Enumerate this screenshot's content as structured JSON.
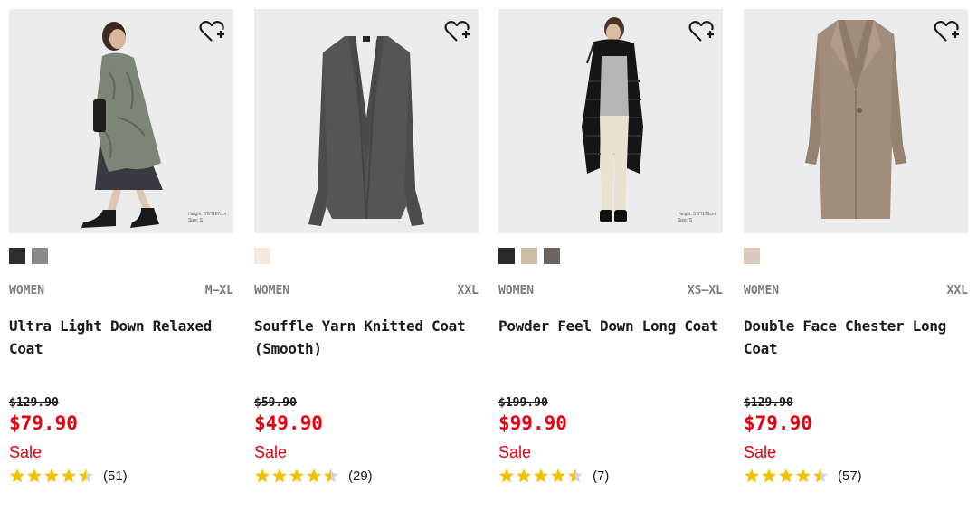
{
  "products": [
    {
      "gender": "WOMEN",
      "sizes": "M–XL",
      "title": "Ultra Light Down Relaxed Coat",
      "old_price": "$129.90",
      "price": "$79.90",
      "sale_label": "Sale",
      "rating": 4.5,
      "review_count": "(51)",
      "model_height": "Height: 5'6\"/167cm",
      "model_size": "Size: S",
      "swatch_colors": [
        "#2e2e2e",
        "#8a8a8a"
      ],
      "image": "woman-in-green-quilted-coat"
    },
    {
      "gender": "WOMEN",
      "sizes": "XXL",
      "title": "Souffle Yarn Knitted Coat (Smooth)",
      "old_price": "$59.90",
      "price": "$49.90",
      "sale_label": "Sale",
      "rating": 4.5,
      "review_count": "(29)",
      "swatch_colors": [
        "#f7e9dc"
      ],
      "image": "gray-knitted-long-coat"
    },
    {
      "gender": "WOMEN",
      "sizes": "XS–XL",
      "title": "Powder Feel Down Long Coat",
      "old_price": "$199.90",
      "price": "$99.90",
      "sale_label": "Sale",
      "rating": 4.5,
      "review_count": "(7)",
      "model_height": "Height: 5'8\"/173cm",
      "model_size": "Size: S",
      "swatch_colors": [
        "#2a2a2a",
        "#cdbfa7",
        "#6d6360"
      ],
      "image": "woman-in-black-down-coat"
    },
    {
      "gender": "WOMEN",
      "sizes": "XXL",
      "title": "Double Face Chester Long Coat",
      "old_price": "$129.90",
      "price": "$79.90",
      "sale_label": "Sale",
      "rating": 4.5,
      "review_count": "(57)",
      "swatch_colors": [
        "#dbc9b9"
      ],
      "image": "beige-chester-long-coat"
    }
  ],
  "colors": {
    "price_red": "#e60012",
    "star_gold": "#f2c200",
    "meta_gray": "#7d7d7d"
  },
  "icons": {
    "favorite": "heart-plus-icon",
    "star": "star-icon"
  }
}
